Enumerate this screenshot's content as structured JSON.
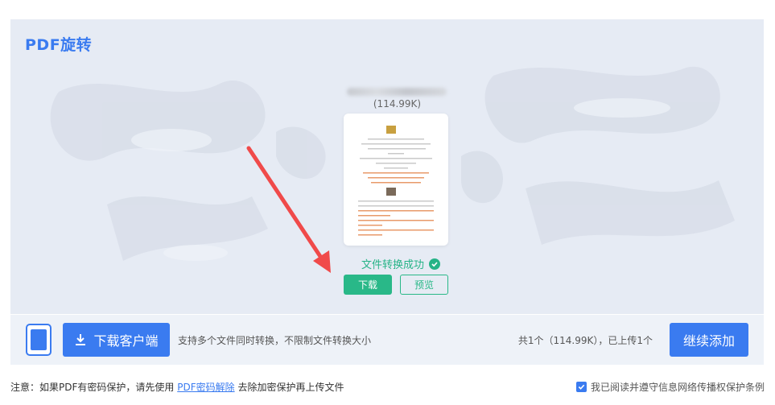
{
  "panel": {
    "title": "PDF旋转",
    "file": {
      "size": "(114.99K)",
      "status": "文件转换成功"
    },
    "buttons": {
      "download": "下载",
      "preview": "预览"
    }
  },
  "bottom_bar": {
    "client_download": "下载客户端",
    "support_text": "支持多个文件同时转换，不限制文件转换大小",
    "count_text": "共1个（114.99K），已上传1个",
    "continue_add": "继续添加"
  },
  "footer": {
    "note_prefix": "注意：如果PDF有密码保护，请先使用",
    "note_link": "PDF密码解除",
    "note_suffix": " 去除加密保护再上传文件",
    "agreement": "我已阅读并遵守信息网络传播权保护条例",
    "agreement_checked": true
  },
  "colors": {
    "accent": "#3a7bf0",
    "success": "#29b888",
    "arrow": "#f04a4a"
  },
  "icons": [
    "success-check-icon",
    "download-icon",
    "tablet-icon",
    "checkbox-icon",
    "red-arrow"
  ]
}
